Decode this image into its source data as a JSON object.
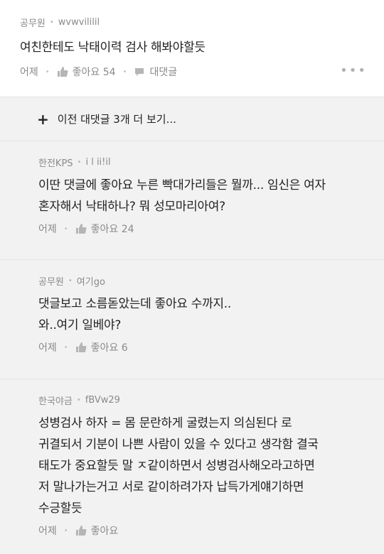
{
  "post": {
    "author": "공무원",
    "nickname": "wvwvililil",
    "text": "여친한테도 낙태이력 검사 해봐야할듯",
    "time": "어제",
    "like_label": "좋아요 54",
    "reply_label": "대댓글",
    "more": "•••"
  },
  "load_more": {
    "plus": "+",
    "label": "이전 대댓글 3개 더 보기..."
  },
  "replies": [
    {
      "author": "한전KPS",
      "nickname": "i l ii!il",
      "lines": [
        "이딴 댓글에 좋아요 누른 빡대가리들은 뭘까... 임신은 여자",
        "혼자해서 낙태하나? 뭐 성모마리아여?"
      ],
      "time": "어제",
      "like_label": "좋아요 24"
    },
    {
      "author": "공무원",
      "nickname": "여기go",
      "lines": [
        "댓글보고 소름돋았는데 좋아요 수까지..",
        "와..여기 일베야?"
      ],
      "time": "어제",
      "like_label": "좋아요 6"
    },
    {
      "author": "한국야금",
      "nickname": "fBVw29",
      "lines": [
        "성병검사 하자 = 몸 문란하게 굴렸는지 의심된다 로",
        "귀결되서 기분이 나쁜 사람이 있을 수 있다고 생각함 결국",
        "태도가 중요할듯 말 ㅈ같이하면서 성병검사해오라고하면",
        "저 말나가는거고 서로 같이하려가자 납득가게얘기하면",
        "수긍할듯"
      ],
      "time": "어제",
      "like_label": "좋아요"
    }
  ],
  "colors": {
    "background": "#f2f2f2",
    "card": "#ffffff",
    "meta_text": "#8a8a8a",
    "body_text": "#222222"
  },
  "icons": {
    "like": "thumbs-up-icon",
    "reply": "speech-bubble-icon",
    "more": "more-dots-icon"
  }
}
